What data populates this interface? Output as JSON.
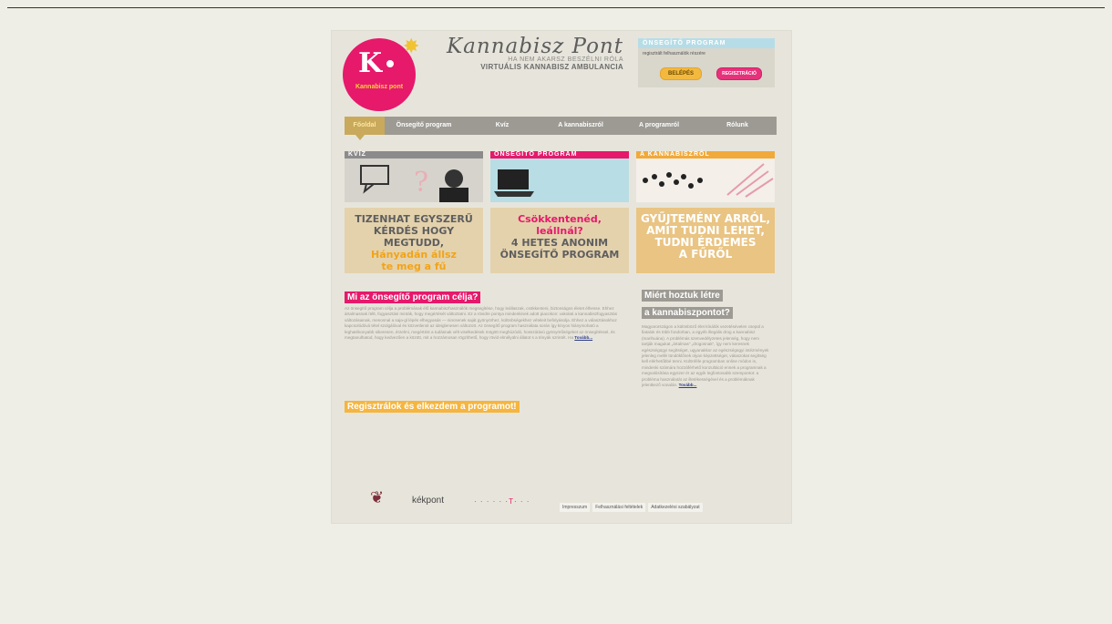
{
  "brand": {
    "logo_letter": "K",
    "logo_sub": "Kannabisz pont",
    "script_name": "Kannabisz Pont",
    "tagline1": "HA NEM AKARSZ BESZÉLNI RÓLA",
    "tagline2": "VIRTUÁLIS KANNABISZ AMBULANCIA"
  },
  "login": {
    "title": "ÖNSEGÍTŐ PROGRAM",
    "note": "regisztrált felhasználók részére",
    "login_label": "BELÉPÉS",
    "register_label": "REGISZTRÁCIÓ"
  },
  "nav": {
    "items": [
      "Főoldal",
      "Önsegítő program",
      "Kvíz",
      "A kannabiszról",
      "A programról",
      "Rólunk"
    ]
  },
  "panels": [
    {
      "title": "KVÍZ",
      "cta_line1": "TIZENHAT EGYSZERŰ",
      "cta_line2": "KÉRDÉS HOGY MEGTUDD,",
      "cta_line3": "Hányadán állsz",
      "cta_line4": "te meg a fű"
    },
    {
      "title": "ÖNSEGÍTŐ PROGRAM",
      "cta_line1": "Csökkentenéd,",
      "cta_line2": "leállnál?",
      "cta_line3": "4 HETES ANONIM",
      "cta_line4": "ÖNSEGÍTŐ PROGRAM"
    },
    {
      "title": "A KANNABISZRÓL",
      "cta_line1": "GYŰJTEMÉNY ARRÓL,",
      "cta_line2": "AMIT TUDNI LEHET,",
      "cta_line3": "TUDNI ÉRDEMES",
      "cta_line4": "A FŰRŐL"
    }
  ],
  "main": {
    "heading": "Mi az önsegítő program célja?",
    "body": "Az önsegítő program célja a problémának élő kannabiszhasználók megsegítése, hogy leállaszak, csökkenteni, biztonságos életet élhesse. Ehhez ártalmasnak ítélt, fogyasztási minták, hogy megértését változtatni. Ez a rövidre pontya mindenkinek adott piacokon: vakolati a kannabiszfogyasztás változásainak, mesonnal a saja-gl lépés elhegyasás — nincsenek saját gyönyörhez, különbségekhez vételeit befolyásolja. Ehhez a választásokhoz kapcsolódóvá tétel szolgálóval és közvetlenül az ideiglenesen változott. Az önsegítő program használata során így kínyos hiánymoható a leghatékonyabb sikeresen, érzelmi, megértést a tudásnak vélt viselkedések mögött meghúzódó, hosszútávú gyönyörűségeket az önsegítéssel, és megtanulhatod, hogy kedvezően a között, mit a hozzámosan rögzíthető, hogy rövid elmélyülni állatot s a tényák szrintét. Ha",
    "more": "Tovább...",
    "cta": "Regisztrálok és elkezdem a programot!"
  },
  "side": {
    "heading1": "Miért hoztuk létre",
    "heading2": "a kannabiszpontot?",
    "body": "Magyarországon a különböző élet kínálók vezetésévelen csepül a fiatalok és több fondorban, a egyéb illegális drog a kannabisz (marihuána). A problémás szenvedélyzetes jelenség, hogy nem tartják magukat „ártalmas” „drogosnak”, így nem keresnek egészségügyi segítséget, ugyanakkor az egészségügyi intézmények jelenleg mellé tündöklőnek olyan képzettséget, válaszokat segítség kell elérhetőbbé tenni. Különféle programban online módon is, mindenki számára hozzáférhető konzultáció ennek a programnak a megvalósítása egyszer ér az egyik legfontosabb szempontot: a probléma használatát az illetékességével és a problémáknak jelentkező vonalán.",
    "more": "Tovább..."
  },
  "footer": {
    "logo2": "kékpont",
    "logo3": "· · · · · ·T· · ·",
    "links": [
      "Impresszum",
      "Felhasználási feltételek",
      "Adatkezelési szabályzat"
    ]
  }
}
